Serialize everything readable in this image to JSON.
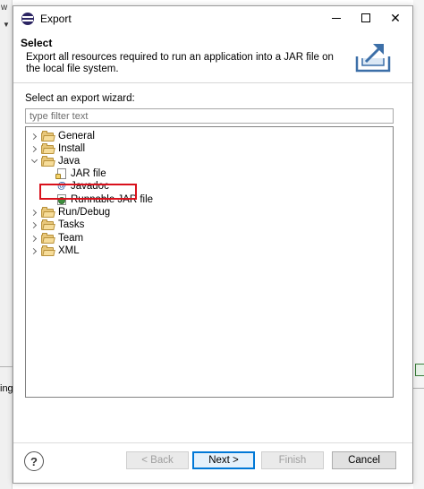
{
  "window": {
    "title": "Export"
  },
  "header": {
    "title": "Select",
    "description": "Export all resources required to run an application into a JAR file on the local file system."
  },
  "wizard": {
    "label": "Select an export wizard:",
    "filter_placeholder": "type filter text",
    "filter_value": "",
    "tree": [
      {
        "label": "General",
        "type": "folder",
        "expanded": false,
        "indent": 0
      },
      {
        "label": "Install",
        "type": "folder",
        "expanded": false,
        "indent": 0
      },
      {
        "label": "Java",
        "type": "folder",
        "expanded": true,
        "indent": 0
      },
      {
        "label": "JAR file",
        "type": "jar-file",
        "indent": 1
      },
      {
        "label": "Javadoc",
        "type": "javadoc",
        "indent": 1
      },
      {
        "label": "Runnable JAR file",
        "type": "runnable-jar",
        "indent": 1,
        "highlighted": true
      },
      {
        "label": "Run/Debug",
        "type": "folder",
        "expanded": false,
        "indent": 0
      },
      {
        "label": "Tasks",
        "type": "folder",
        "expanded": false,
        "indent": 0
      },
      {
        "label": "Team",
        "type": "folder",
        "expanded": false,
        "indent": 0
      },
      {
        "label": "XML",
        "type": "folder",
        "expanded": false,
        "indent": 0
      }
    ]
  },
  "buttons": {
    "help": "?",
    "back": "< Back",
    "next": "Next >",
    "finish": "Finish",
    "cancel": "Cancel"
  },
  "background": {
    "menu_fragment": "w",
    "text_fragment": "ing"
  },
  "colors": {
    "highlight_border": "#d9111c",
    "default_button_border": "#0078d7",
    "folder": "#e8c77a"
  }
}
